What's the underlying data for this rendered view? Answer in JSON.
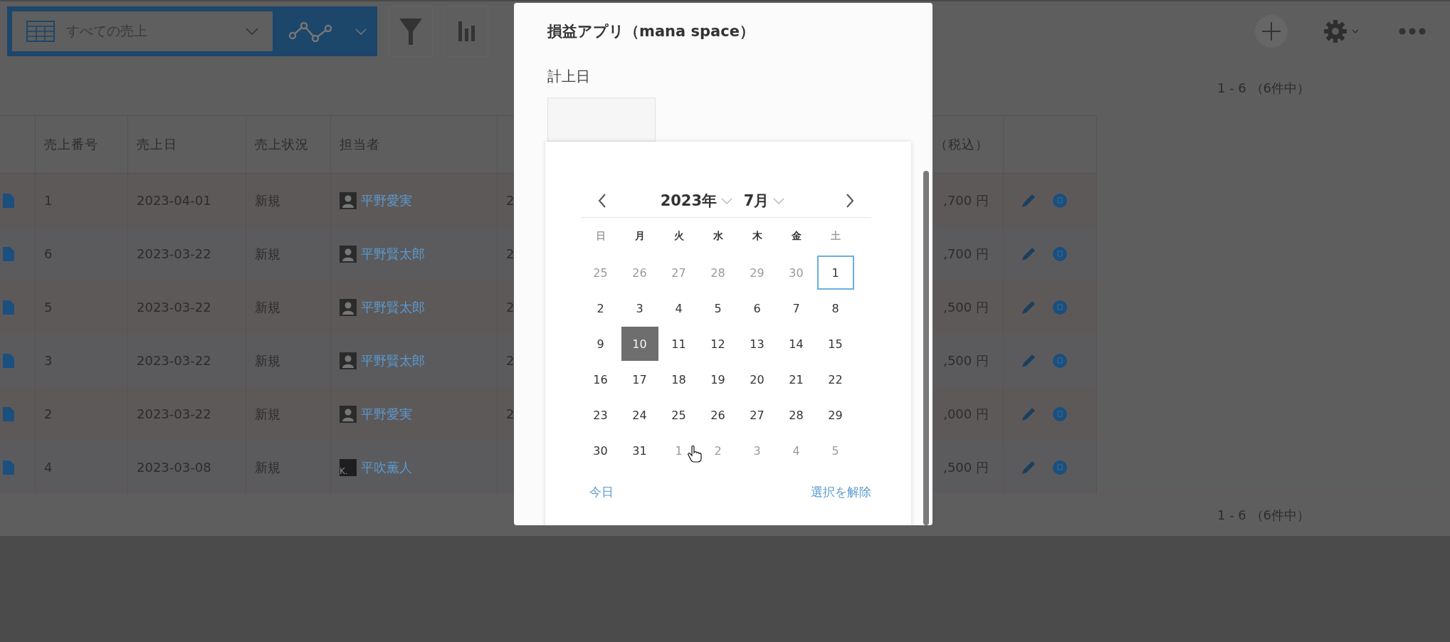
{
  "toolbar": {
    "view_selector": {
      "label": "すべての売上"
    }
  },
  "pagination_top": "1 - 6 （6件中）",
  "table": {
    "columns": {
      "number": "売上番号",
      "date": "売上日",
      "status": "売上状況",
      "assignee": "担当者",
      "amount": "（税込）"
    },
    "rows": [
      {
        "number": "1",
        "date": "2023-04-01",
        "status": "新規",
        "assignee": {
          "name": "平野愛実",
          "kind": "silhouette"
        },
        "column_6": "2",
        "amount": ",700 円"
      },
      {
        "number": "6",
        "date": "2023-03-22",
        "status": "新規",
        "assignee": {
          "name": "平野賢太郎",
          "kind": "silhouette"
        },
        "column_6": "2",
        "amount": ",700 円"
      },
      {
        "number": "5",
        "date": "2023-03-22",
        "status": "新規",
        "assignee": {
          "name": "平野賢太郎",
          "kind": "silhouette"
        },
        "column_6": "2",
        "amount": ",500 円"
      },
      {
        "number": "3",
        "date": "2023-03-22",
        "status": "新規",
        "assignee": {
          "name": "平野賢太郎",
          "kind": "silhouette"
        },
        "column_6": "2",
        "amount": ",500 円"
      },
      {
        "number": "2",
        "date": "2023-03-22",
        "status": "新規",
        "assignee": {
          "name": "平野愛実",
          "kind": "silhouette"
        },
        "column_6": "2",
        "amount": ",000 円"
      },
      {
        "number": "4",
        "date": "2023-03-08",
        "status": "新規",
        "assignee": {
          "name": "平吹薫人",
          "kind": "initial",
          "initial": "K."
        },
        "amount": ",500 円"
      }
    ]
  },
  "pagination_bottom": "1 - 6 （6件中）",
  "modal": {
    "title": "損益アプリ（mana space）",
    "field": {
      "label": "計上日"
    },
    "calendar": {
      "year": "2023年",
      "month": "7月",
      "weekdays": [
        {
          "label": "日",
          "weekend": true
        },
        {
          "label": "月",
          "weekend": false
        },
        {
          "label": "火",
          "weekend": false
        },
        {
          "label": "水",
          "weekend": false
        },
        {
          "label": "木",
          "weekend": false
        },
        {
          "label": "金",
          "weekend": false
        },
        {
          "label": "土",
          "weekend": true
        }
      ],
      "weeks": [
        [
          {
            "label": "25",
            "outside": true,
            "selected": false,
            "focused": false
          },
          {
            "label": "26",
            "outside": true,
            "selected": false,
            "focused": false
          },
          {
            "label": "27",
            "outside": true,
            "selected": false,
            "focused": false
          },
          {
            "label": "28",
            "outside": true,
            "selected": false,
            "focused": false
          },
          {
            "label": "29",
            "outside": true,
            "selected": false,
            "focused": false
          },
          {
            "label": "30",
            "outside": true,
            "selected": false,
            "focused": false
          },
          {
            "label": "1",
            "outside": false,
            "selected": false,
            "focused": true
          }
        ],
        [
          {
            "label": "2",
            "outside": false,
            "selected": false,
            "focused": false
          },
          {
            "label": "3",
            "outside": false,
            "selected": false,
            "focused": false
          },
          {
            "label": "4",
            "outside": false,
            "selected": false,
            "focused": false
          },
          {
            "label": "5",
            "outside": false,
            "selected": false,
            "focused": false
          },
          {
            "label": "6",
            "outside": false,
            "selected": false,
            "focused": false
          },
          {
            "label": "7",
            "outside": false,
            "selected": false,
            "focused": false
          },
          {
            "label": "8",
            "outside": false,
            "selected": false,
            "focused": false
          }
        ],
        [
          {
            "label": "9",
            "outside": false,
            "selected": false,
            "focused": false
          },
          {
            "label": "10",
            "outside": false,
            "selected": true,
            "focused": false
          },
          {
            "label": "11",
            "outside": false,
            "selected": false,
            "focused": false
          },
          {
            "label": "12",
            "outside": false,
            "selected": false,
            "focused": false
          },
          {
            "label": "13",
            "outside": false,
            "selected": false,
            "focused": false
          },
          {
            "label": "14",
            "outside": false,
            "selected": false,
            "focused": false
          },
          {
            "label": "15",
            "outside": false,
            "selected": false,
            "focused": false
          }
        ],
        [
          {
            "label": "16",
            "outside": false,
            "selected": false,
            "focused": false
          },
          {
            "label": "17",
            "outside": false,
            "selected": false,
            "focused": false
          },
          {
            "label": "18",
            "outside": false,
            "selected": false,
            "focused": false
          },
          {
            "label": "19",
            "outside": false,
            "selected": false,
            "focused": false
          },
          {
            "label": "20",
            "outside": false,
            "selected": false,
            "focused": false
          },
          {
            "label": "21",
            "outside": false,
            "selected": false,
            "focused": false
          },
          {
            "label": "22",
            "outside": false,
            "selected": false,
            "focused": false
          }
        ],
        [
          {
            "label": "23",
            "outside": false,
            "selected": false,
            "focused": false
          },
          {
            "label": "24",
            "outside": false,
            "selected": false,
            "focused": false
          },
          {
            "label": "25",
            "outside": false,
            "selected": false,
            "focused": false
          },
          {
            "label": "26",
            "outside": false,
            "selected": false,
            "focused": false
          },
          {
            "label": "27",
            "outside": false,
            "selected": false,
            "focused": false
          },
          {
            "label": "28",
            "outside": false,
            "selected": false,
            "focused": false
          },
          {
            "label": "29",
            "outside": false,
            "selected": false,
            "focused": false
          }
        ],
        [
          {
            "label": "30",
            "outside": false,
            "selected": false,
            "focused": false
          },
          {
            "label": "31",
            "outside": false,
            "selected": false,
            "focused": false
          },
          {
            "label": "1",
            "outside": true,
            "selected": false,
            "focused": false
          },
          {
            "label": "2",
            "outside": true,
            "selected": false,
            "focused": false
          },
          {
            "label": "3",
            "outside": true,
            "selected": false,
            "focused": false
          },
          {
            "label": "4",
            "outside": true,
            "selected": false,
            "focused": false
          },
          {
            "label": "5",
            "outside": true,
            "selected": false,
            "focused": false
          }
        ]
      ],
      "today_link": "今日",
      "clear_link": "選択を解除"
    }
  }
}
